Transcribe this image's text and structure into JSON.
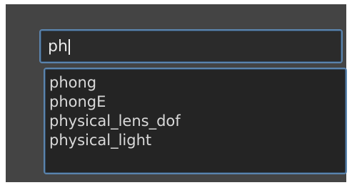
{
  "search": {
    "value": "ph"
  },
  "suggestions": [
    {
      "label": "phong"
    },
    {
      "label": "phongE"
    },
    {
      "label": "physical_lens_dof"
    },
    {
      "label": "physical_light"
    }
  ],
  "colors": {
    "panel_background": "#444444",
    "input_background": "#2b2b2b",
    "dropdown_background": "#242424",
    "focus_border": "#5b84ad",
    "text": "#d9d9d9"
  }
}
